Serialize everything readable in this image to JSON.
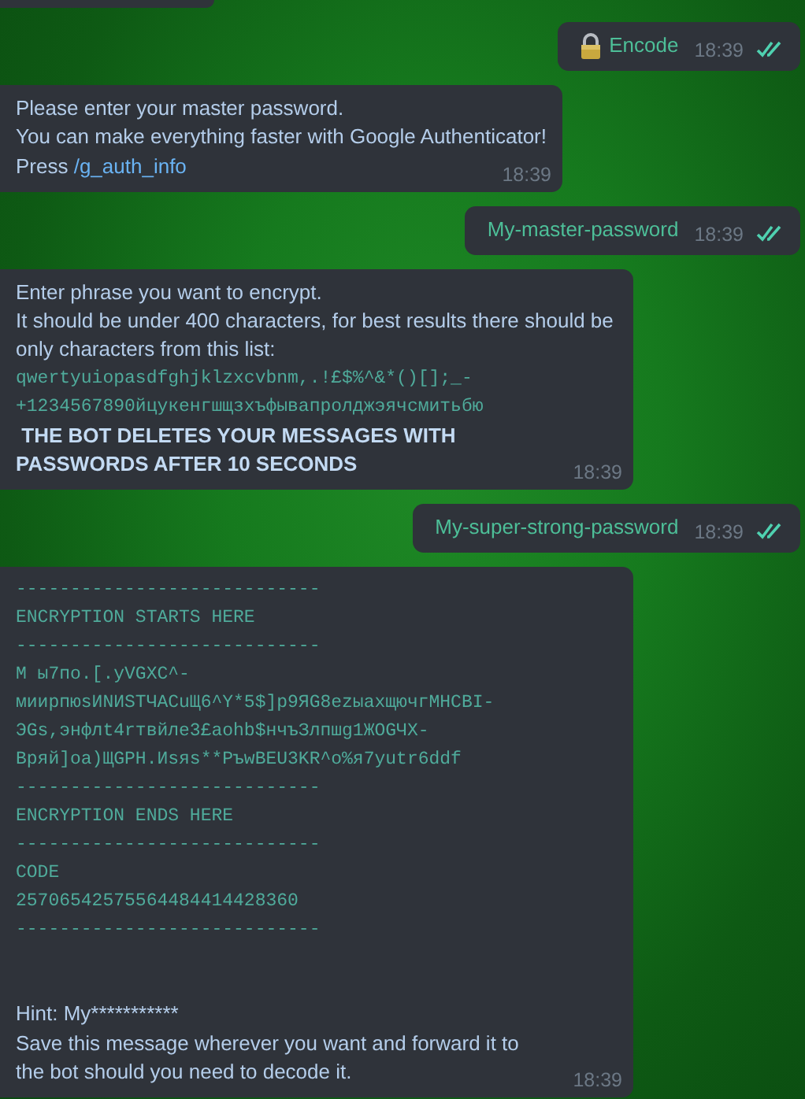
{
  "messages": [
    {
      "kind": "outgoing_locked",
      "text": "Encode",
      "time": "18:39",
      "read": true
    },
    {
      "kind": "incoming",
      "time": "18:39",
      "blocks": [
        {
          "kind": "text",
          "text": "Please enter your master password."
        },
        {
          "kind": "text",
          "text": "You can make everything faster with Google Authenticator!"
        },
        {
          "kind": "command",
          "prefix": "Press ",
          "command": "/g_auth_info"
        }
      ]
    },
    {
      "kind": "outgoing",
      "text": "My-master-password",
      "time": "18:39",
      "read": true
    },
    {
      "kind": "incoming",
      "time": "18:39",
      "blocks": [
        {
          "kind": "text",
          "text": "Enter phrase you want to encrypt."
        },
        {
          "kind": "text",
          "text": "It should be under 400 characters, for best results there should be only characters from this list:"
        },
        {
          "kind": "mono",
          "lines": [
            "qwertyuiopasdfghjklzxcvbnm,.!£$%^&*()[];_-",
            "+1234567890йцукенгшщзхъфывапролджэячсмитьбю"
          ]
        },
        {
          "kind": "bold",
          "text": " THE BOT DELETES YOUR MESSAGES WITH PASSWORDS AFTER 10 SECONDS"
        }
      ]
    },
    {
      "kind": "outgoing",
      "text": "My-super-strong-password",
      "time": "18:39",
      "read": true
    },
    {
      "kind": "incoming",
      "time": "18:39",
      "blocks": [
        {
          "kind": "mono",
          "lines": [
            "----------------------------",
            "ENCRYPTION STARTS HERE",
            "----------------------------",
            "М ы7по.[.yVGXC^-",
            "миирпюsИNИSTЧACuЩ6^Y*5$]p9ЯG8ezыaxщючгMHCBI-",
            "ЭGs,энфлt4rтвйлe3£aohb$нчъЗлпшg1ЖOGЧX-",
            "Bряй]oa)ЩGPH.Иsяs**PъwBEU3KR^o%я7yutr6ddf",
            "----------------------------",
            "ENCRYPTION ENDS HERE",
            "----------------------------",
            "CODE",
            "25706542575564484414428360",
            "----------------------------"
          ]
        },
        {
          "kind": "spaced_text",
          "text": "Hint: My***********"
        },
        {
          "kind": "text",
          "text": "Save this message wherever you want and forward it to the bot should you need to decode it."
        }
      ]
    }
  ]
}
